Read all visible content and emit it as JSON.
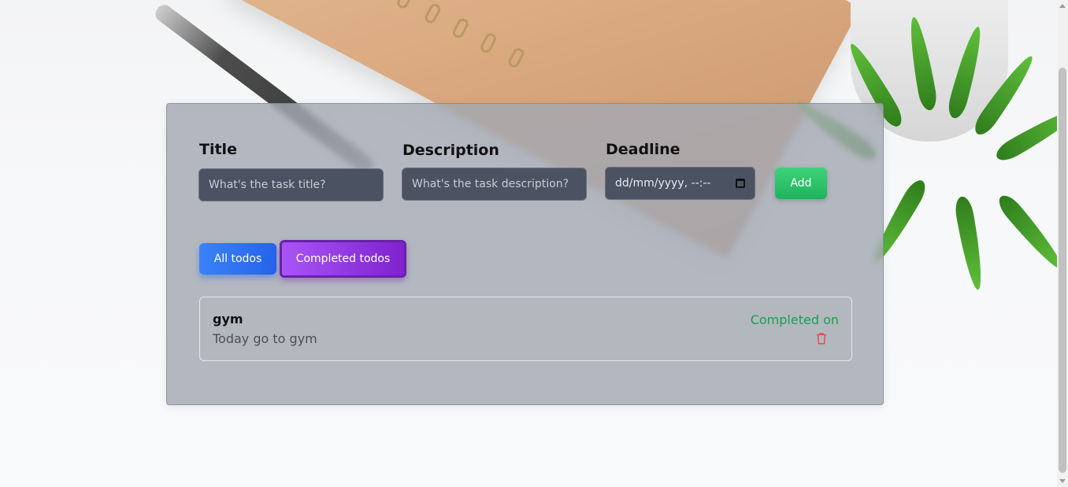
{
  "form": {
    "title_label": "Title",
    "title_placeholder": "What's the task title?",
    "description_label": "Description",
    "description_placeholder": "What's the task description?",
    "deadline_label": "Deadline",
    "deadline_placeholder": "dd/mm/yyyy, --:--",
    "add_label": "Add"
  },
  "tabs": {
    "all_label": "All todos",
    "completed_label": "Completed todos",
    "active": "completed"
  },
  "todos": [
    {
      "title": "gym",
      "description": "Today go to gym",
      "status": "Completed on",
      "delete_icon": "trash-icon"
    }
  ],
  "colors": {
    "add": "#22c55e",
    "all_tab": "#3b82f6",
    "completed_tab": "#9333ea",
    "status_text": "#16a34a",
    "delete_icon": "#ef4444"
  }
}
